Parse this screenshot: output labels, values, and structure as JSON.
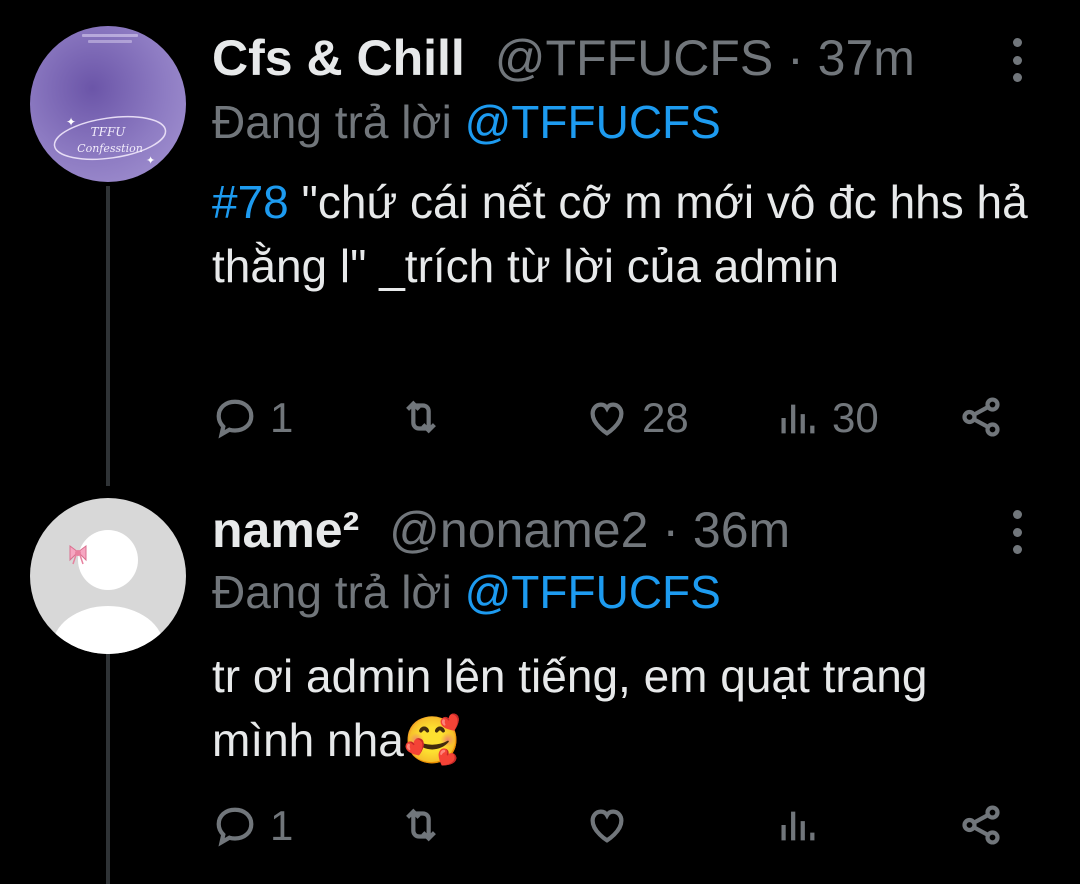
{
  "tweets": [
    {
      "display_name": "Cfs & Chill",
      "handle": "@TFFUCFS",
      "time": "37m",
      "reply_prefix": "Đang trả lời ",
      "reply_mention": "@TFFUCFS",
      "hashtag": "#78",
      "body": " \"chứ cái nết cỡ m mới vô đc hhs hả thằng l\" _trích từ lời của admin",
      "avatar_text": "TFFU Confesstion",
      "reply_count": "1",
      "retweet_count": "",
      "like_count": "28",
      "view_count": "30"
    },
    {
      "display_name": "name²",
      "handle": "@noname2",
      "time": "36m",
      "reply_prefix": "Đang trả lời ",
      "reply_mention": "@TFFUCFS",
      "body": "tr ơi admin lên tiếng, em quạt trang mình nha",
      "emoji": "🥰",
      "reply_count": "1",
      "retweet_count": "",
      "like_count": "",
      "view_count": ""
    }
  ],
  "colors": {
    "background": "#000000",
    "text": "#e7e9ea",
    "secondary": "#71767b",
    "accent": "#1d9bf0",
    "thread_line": "#2f3336"
  },
  "icons": [
    "reply-icon",
    "retweet-icon",
    "like-icon",
    "views-icon",
    "share-icon",
    "more-icon",
    "bow-icon"
  ]
}
